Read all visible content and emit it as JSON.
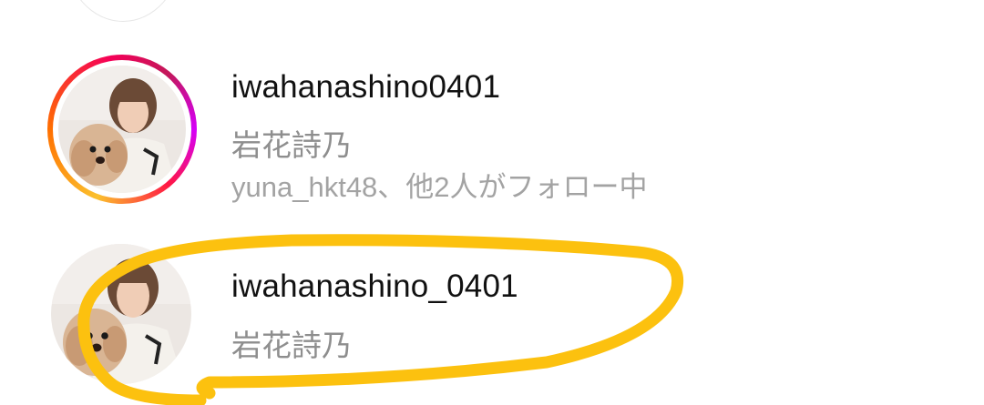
{
  "results": [
    {
      "username": "iwahanashino0401",
      "full_name": "岩花詩乃",
      "followed_by": "yuna_hkt48、他2人がフォロー中",
      "has_story_ring": true
    },
    {
      "username": "iwahanashino_0401",
      "full_name": "岩花詩乃",
      "has_story_ring": false
    }
  ],
  "annotation": {
    "type": "hand-drawn-circle",
    "color": "#fcc10f"
  }
}
